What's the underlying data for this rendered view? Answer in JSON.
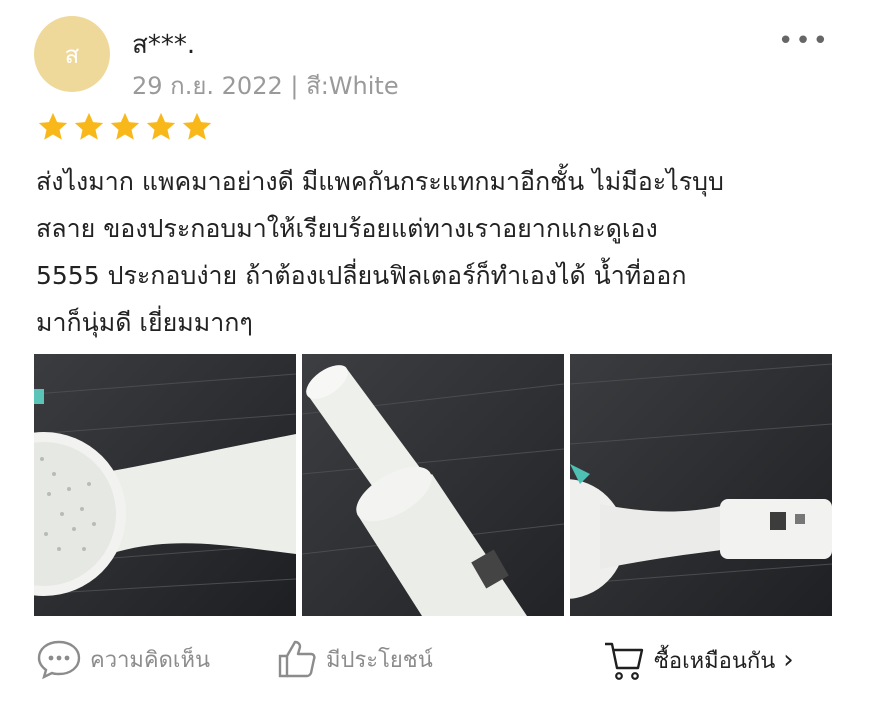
{
  "reviewer": {
    "avatar_initial": "ส",
    "username": "ส***.",
    "meta": "29 ก.ย. 2022 | สี:White"
  },
  "rating": {
    "value": 5,
    "max": 5,
    "color": "#f9b81a"
  },
  "review_text": [
    "ส่งไงมาก แพคมาอย่างดี มีแพคกันกระแทกมาอีกชั้น ไม่มีอะไรบุบ",
    "สลาย ของประกอบมาให้เรียบร้อยแต่ทางเราอยากแกะดูเอง",
    "5555  ประกอบง่าย ถ้าต้องเปลี่ยนฟิลเตอร์ก็ทำเองได้ น้ำที่ออก",
    "มาก็นุ่มดี เยี่ยมมากๆ"
  ],
  "more_menu_glyph": "•••",
  "photos": [
    "shower-head-front",
    "shower-handle-filter",
    "shower-filter-cartridge"
  ],
  "actions": {
    "comment_label": "ความคิดเห็น",
    "helpful_label": "มีประโยชน์",
    "buy_label": "ซื้อเหมือนกัน",
    "buy_chevron": "›"
  },
  "colors": {
    "avatar_bg": "#efd99a",
    "muted": "#9a9a9a"
  },
  "icons": {
    "comment": "chat-bubble-icon",
    "helpful": "thumbs-up-icon",
    "buy": "cart-icon"
  }
}
